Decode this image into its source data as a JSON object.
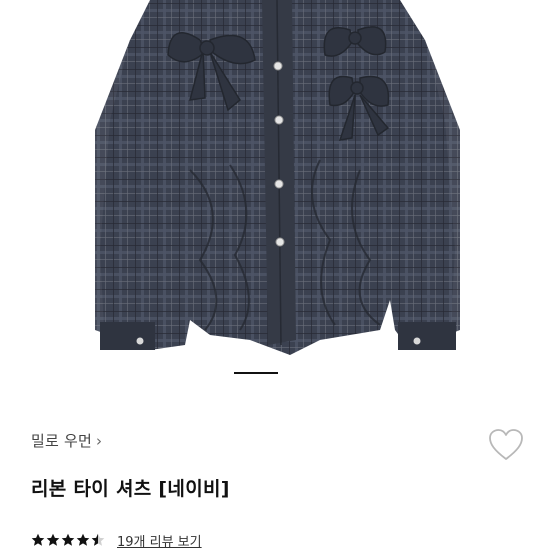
{
  "product": {
    "image_alt": "",
    "carousel": {
      "current": 1
    },
    "brand": "밀로 우먼",
    "brand_chevron": "›",
    "title": "리본 타이 셔츠 [네이비]",
    "rating_value": 4.5,
    "reviews_link": "19개 리뷰 보기",
    "icons": {
      "wishlist": "heart-outline-icon",
      "brand_link": "chevron-right-icon",
      "rating": "star-icon"
    },
    "colors": {
      "fabric": "#3b4150",
      "fabric_dark": "#2a2f3a",
      "star": "#111111",
      "heart_stroke": "#b8b8b8"
    }
  }
}
